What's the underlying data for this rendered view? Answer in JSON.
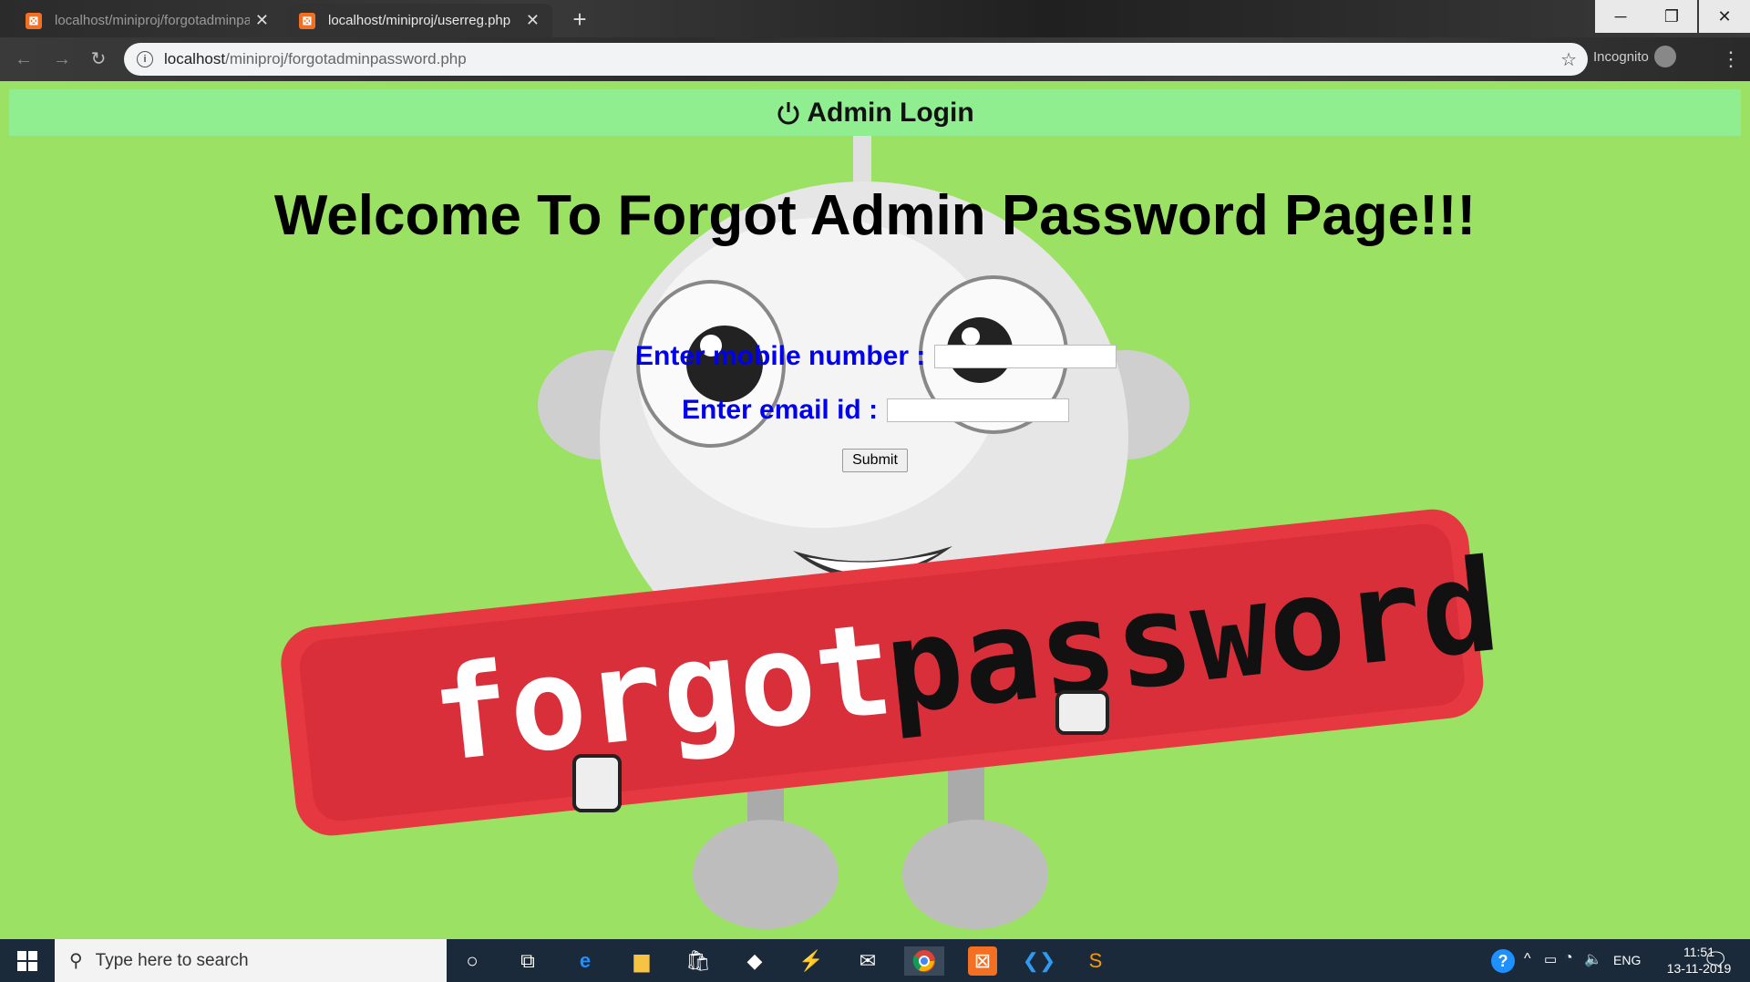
{
  "browser": {
    "tabs": [
      {
        "title": "localhost/miniproj/forgotadminpassword.php",
        "active": false
      },
      {
        "title": "localhost/miniproj/userreg.php",
        "active": true
      }
    ],
    "url_host": "localhost",
    "url_path": "/miniproj/forgotadminpassword.php",
    "incognito_label": "Incognito"
  },
  "page": {
    "top_bar_title": "Admin Login",
    "heading": "Welcome To Forgot Admin Password Page!!!",
    "mobile_label": "Enter mobile number :",
    "email_label": "Enter email id :",
    "mobile_value": "",
    "email_value": "",
    "submit_label": "Submit",
    "banner_text_left": "forgot",
    "banner_text_right": "password",
    "colors": {
      "background": "#9be264",
      "top_bar": "#90ee90",
      "label": "#0000ee",
      "banner": "#e63841"
    }
  },
  "taskbar": {
    "search_placeholder": "Type here to search",
    "lang": "ENG",
    "time": "11:51",
    "date": "13-11-2019",
    "apps": [
      "cortana-icon",
      "task-view-icon",
      "edge-icon",
      "file-explorer-icon",
      "store-icon",
      "dropbox-icon",
      "vs-icon",
      "mail-icon",
      "chrome-icon",
      "xampp-icon",
      "vscode-icon",
      "sublime-icon"
    ]
  }
}
